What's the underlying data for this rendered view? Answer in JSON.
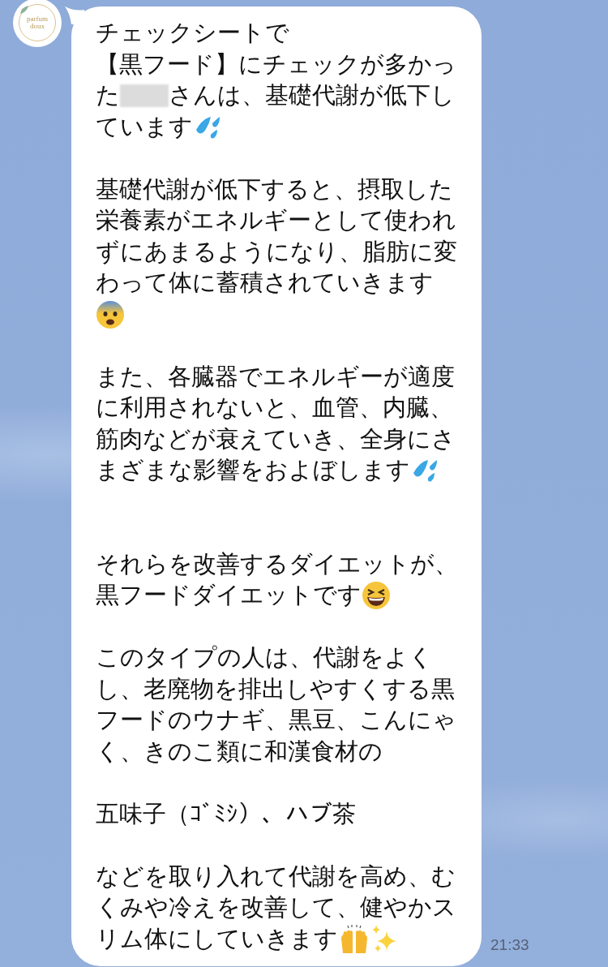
{
  "sender": {
    "avatar": {
      "logo_lines": [
        "parfum",
        "doux"
      ]
    }
  },
  "message": {
    "time": "21:33",
    "lines": [
      {
        "kind": "text",
        "segments": [
          {
            "kind": "text",
            "text": "チェックシートで"
          }
        ]
      },
      {
        "kind": "text",
        "segments": [
          {
            "kind": "text",
            "text": "【黒フード】にチェックが多かっ"
          }
        ]
      },
      {
        "kind": "text",
        "segments": [
          {
            "kind": "text",
            "text": "た"
          },
          {
            "kind": "blur"
          },
          {
            "kind": "text",
            "text": "さんは、基礎代謝が低下し"
          }
        ]
      },
      {
        "kind": "text",
        "segments": [
          {
            "kind": "text",
            "text": "ています"
          },
          {
            "kind": "droplets"
          }
        ]
      },
      {
        "kind": "blank"
      },
      {
        "kind": "text",
        "segments": [
          {
            "kind": "text",
            "text": "基礎代謝が低下すると、摂取した"
          }
        ]
      },
      {
        "kind": "text",
        "segments": [
          {
            "kind": "text",
            "text": "栄養素がエネルギーとして使われ"
          }
        ]
      },
      {
        "kind": "text",
        "segments": [
          {
            "kind": "text",
            "text": "ずにあまるようになり、脂肪に変"
          }
        ]
      },
      {
        "kind": "text",
        "segments": [
          {
            "kind": "text",
            "text": "わって体に蓄積されていきます"
          }
        ]
      },
      {
        "kind": "text",
        "segments": [
          {
            "kind": "fearful"
          }
        ]
      },
      {
        "kind": "blank"
      },
      {
        "kind": "text",
        "segments": [
          {
            "kind": "text",
            "text": "また、各臓器でエネルギーが適度"
          }
        ]
      },
      {
        "kind": "text",
        "segments": [
          {
            "kind": "text",
            "text": "に利用されないと、血管、内臓、"
          }
        ]
      },
      {
        "kind": "text",
        "segments": [
          {
            "kind": "text",
            "text": "筋肉などが衰えていき、全身にさ"
          }
        ]
      },
      {
        "kind": "text",
        "segments": [
          {
            "kind": "text",
            "text": "まざまな影響をおよぼします"
          },
          {
            "kind": "droplets"
          }
        ]
      },
      {
        "kind": "blank"
      },
      {
        "kind": "blank"
      },
      {
        "kind": "text",
        "segments": [
          {
            "kind": "text",
            "text": "それらを改善するダイエットが、"
          }
        ]
      },
      {
        "kind": "text",
        "segments": [
          {
            "kind": "text",
            "text": "黒フードダイエットです"
          },
          {
            "kind": "grin"
          }
        ]
      },
      {
        "kind": "blank"
      },
      {
        "kind": "text",
        "segments": [
          {
            "kind": "text",
            "text": "このタイプの人は、代謝をよく"
          }
        ]
      },
      {
        "kind": "text",
        "segments": [
          {
            "kind": "text",
            "text": "し、老廃物を排出しやすくする黒"
          }
        ]
      },
      {
        "kind": "text",
        "segments": [
          {
            "kind": "text",
            "text": "フードのウナギ、黒豆、こんにゃ"
          }
        ]
      },
      {
        "kind": "text",
        "segments": [
          {
            "kind": "text",
            "text": "く、きのこ類に和漢食材の"
          }
        ]
      },
      {
        "kind": "blank"
      },
      {
        "kind": "text",
        "segments": [
          {
            "kind": "text",
            "text": "五味子（ｺﾞﾐｼ）、ハブ茶"
          }
        ]
      },
      {
        "kind": "blank"
      },
      {
        "kind": "text",
        "segments": [
          {
            "kind": "text",
            "text": "などを取り入れて代謝を高め、む"
          }
        ]
      },
      {
        "kind": "text",
        "segments": [
          {
            "kind": "text",
            "text": "くみや冷えを改善して、健やかス"
          }
        ]
      },
      {
        "kind": "text",
        "segments": [
          {
            "kind": "text",
            "text": "リム体にしていきます"
          },
          {
            "kind": "hands"
          },
          {
            "kind": "sparkles"
          }
        ]
      }
    ]
  }
}
